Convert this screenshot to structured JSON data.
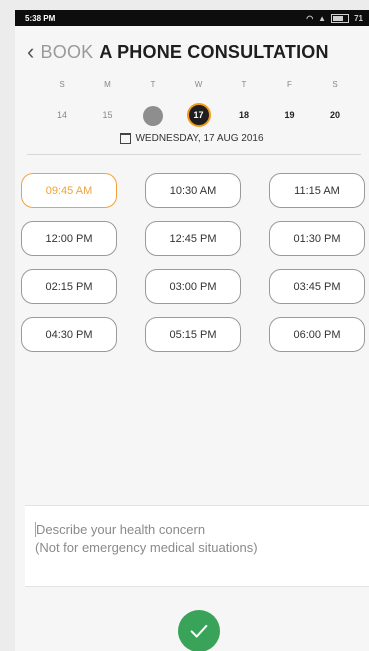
{
  "status_bar": {
    "time": "5:38 PM",
    "battery": "71"
  },
  "header": {
    "back_icon": "chevron-left-icon",
    "title_light": "BOOK",
    "title_bold": "A PHONE CONSULTATION"
  },
  "calendar": {
    "weekdays": [
      "S",
      "M",
      "T",
      "W",
      "T",
      "F",
      "S"
    ],
    "dates": [
      "14",
      "15",
      "",
      "17",
      "18",
      "19",
      "20"
    ],
    "selected_date_text": "WEDNESDAY, 17 AUG 2016"
  },
  "slots": [
    "09:45 AM",
    "10:30 AM",
    "11:15 AM",
    "12:00 PM",
    "12:45 PM",
    "01:30 PM",
    "02:15 PM",
    "03:00 PM",
    "03:45 PM",
    "04:30 PM",
    "05:15 PM",
    "06:00 PM"
  ],
  "selected_slot": "09:45 AM",
  "concern": {
    "placeholder_line1": "Describe your health concern",
    "placeholder_line2": "(Not for emergency medical situations)"
  },
  "submit": {
    "icon": "check-icon",
    "color": "#3aa35a"
  },
  "colors": {
    "accent": "#f29a1a",
    "selected_day_bg": "#1e1e1e"
  }
}
